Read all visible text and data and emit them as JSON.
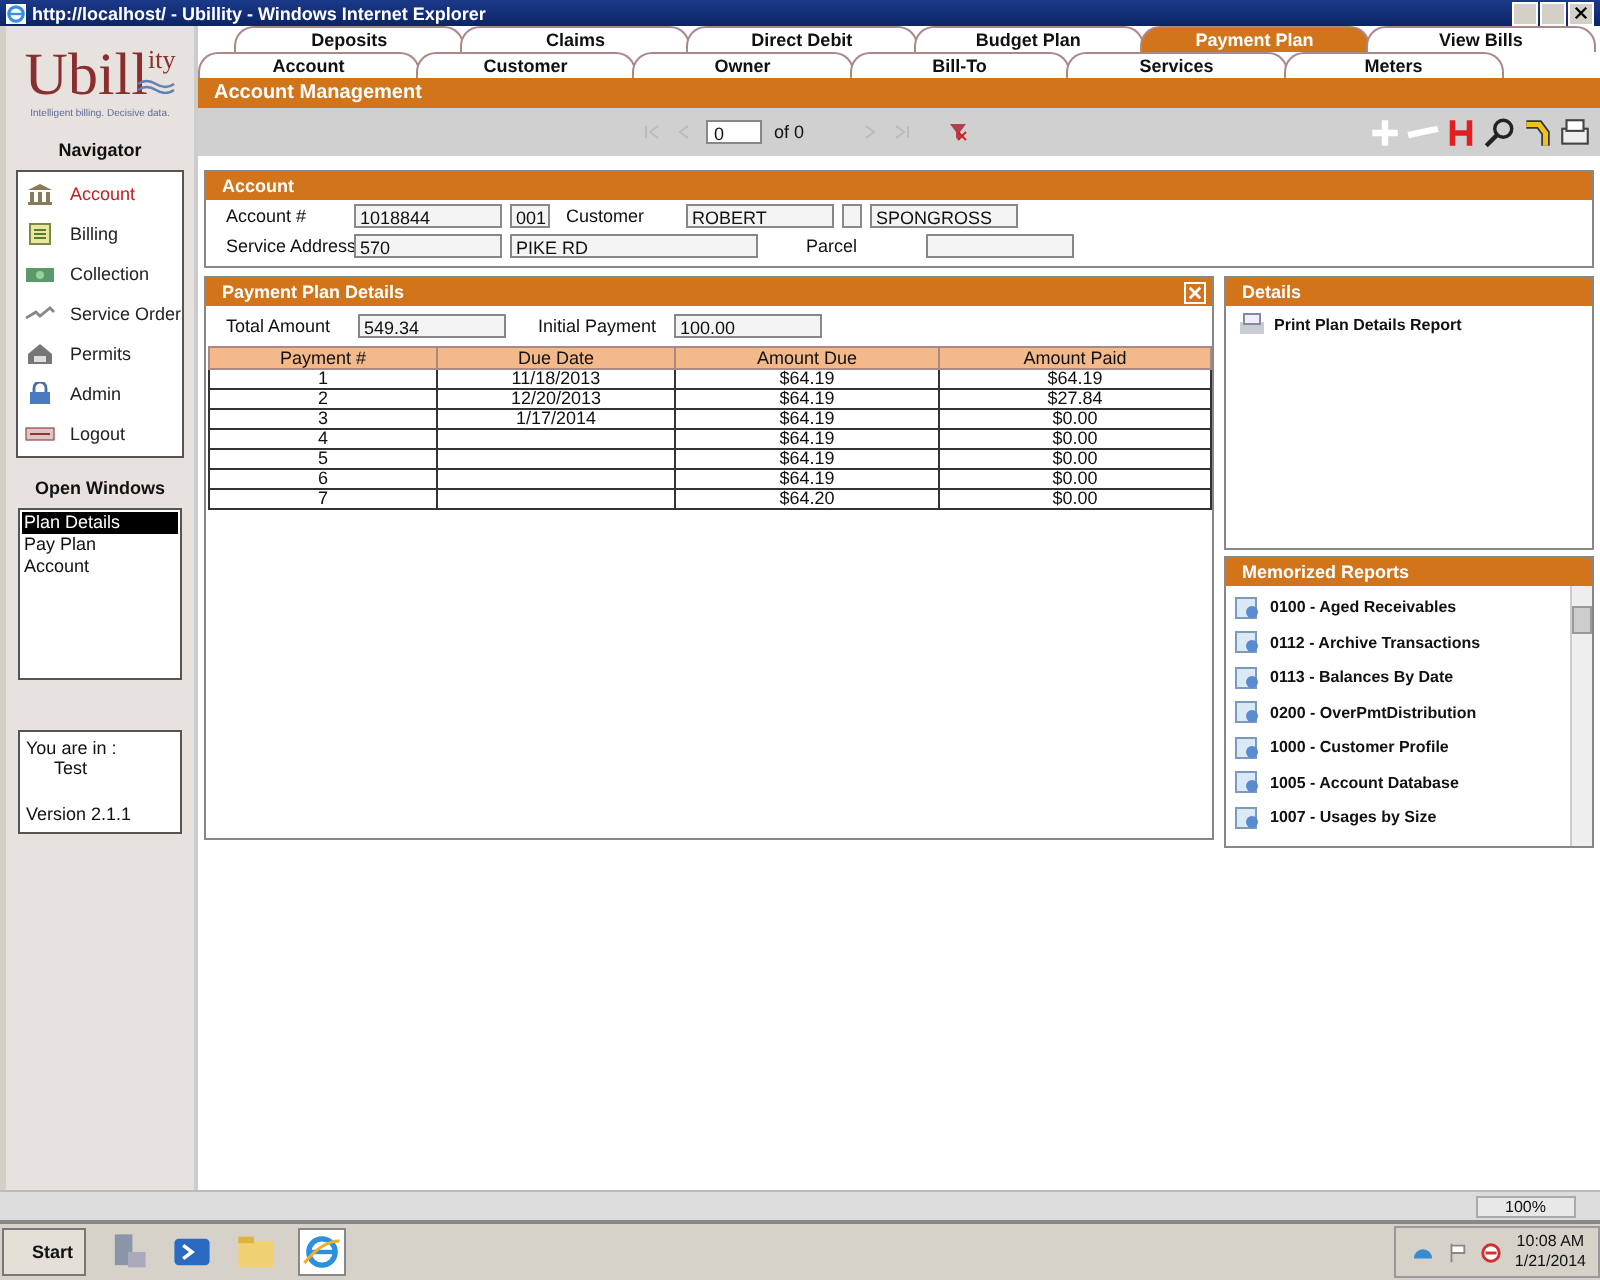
{
  "window": {
    "title": "http://localhost/ - Ubillity - Windows Internet Explorer"
  },
  "logo": {
    "main": "Ubill",
    "sup": "ity",
    "tagline": "Intelligent billing. Decisive data."
  },
  "navigator": {
    "title": "Navigator",
    "items": [
      {
        "label": "Account",
        "kind": "bank",
        "selected": true
      },
      {
        "label": "Billing",
        "kind": "ledger",
        "selected": false
      },
      {
        "label": "Collection",
        "kind": "money",
        "selected": false
      },
      {
        "label": "Service Order",
        "kind": "wrench",
        "selected": false
      },
      {
        "label": "Permits",
        "kind": "house",
        "selected": false
      },
      {
        "label": "Admin",
        "kind": "lock",
        "selected": false
      },
      {
        "label": "Logout",
        "kind": "exit",
        "selected": false
      }
    ]
  },
  "open_windows": {
    "title": "Open Windows",
    "items": [
      {
        "label": "Plan Details",
        "selected": true
      },
      {
        "label": "Pay Plan",
        "selected": false
      },
      {
        "label": "Account",
        "selected": false
      }
    ]
  },
  "session": {
    "line": "You are in :",
    "env": "Test",
    "version": "Version 2.1.1"
  },
  "tabs": {
    "row_1": [
      {
        "label": "Deposits",
        "selected": false
      },
      {
        "label": "Claims",
        "selected": false
      },
      {
        "label": "Direct Debit",
        "selected": false
      },
      {
        "label": "Budget Plan",
        "selected": false
      },
      {
        "label": "Payment Plan",
        "selected": true
      },
      {
        "label": "View Bills",
        "selected": false
      }
    ],
    "row_2": [
      {
        "label": "Account",
        "selected": false
      },
      {
        "label": "Customer",
        "selected": false
      },
      {
        "label": "Owner",
        "selected": false
      },
      {
        "label": "Bill-To",
        "selected": false
      },
      {
        "label": "Services",
        "selected": false
      },
      {
        "label": "Meters",
        "selected": false
      }
    ]
  },
  "header": "Account Management",
  "pager": {
    "value": "0",
    "total": "of 0"
  },
  "account": {
    "title": "Account",
    "rows": [
      [
        {
          "kind": "label",
          "text": "Account #"
        },
        {
          "kind": "input",
          "value": "1018844"
        },
        {
          "kind": "input",
          "value": "001"
        },
        {
          "kind": "label",
          "text": "Customer"
        },
        {
          "kind": "input",
          "value": "ROBERT"
        },
        {
          "kind": "input"
        },
        {
          "kind": "input",
          "value": "SPONGROSS"
        }
      ],
      [
        {
          "kind": "label",
          "text": "Service Address"
        },
        {
          "kind": "input",
          "value": "570"
        },
        {
          "kind": "input",
          "value": "PIKE RD"
        },
        {
          "kind": "label",
          "text": "Parcel"
        },
        {
          "kind": "input"
        }
      ]
    ]
  },
  "plan": {
    "title": "Payment Plan Details",
    "total_label": "Total Amount",
    "total_value": "549.34",
    "initial_label": "Initial Payment",
    "initial_value": "100.00",
    "columns": [
      "Payment #",
      "Due Date",
      "Amount Due",
      "Amount Paid"
    ],
    "rows": [
      [
        "1",
        "11/18/2013",
        "$64.19",
        "$64.19"
      ],
      [
        "2",
        "12/20/2013",
        "$64.19",
        "$27.84"
      ],
      [
        "3",
        "1/17/2014",
        "$64.19",
        "$0.00"
      ],
      [
        "4",
        "",
        "$64.19",
        "$0.00"
      ],
      [
        "5",
        "",
        "$64.19",
        "$0.00"
      ],
      [
        "6",
        "",
        "$64.19",
        "$0.00"
      ],
      [
        "7",
        "",
        "$64.20",
        "$0.00"
      ]
    ]
  },
  "details": {
    "title": "Details",
    "items": [
      "Print  Plan Details Report"
    ]
  },
  "reports": {
    "title": "Memorized Reports",
    "items": [
      "0100 - Aged Receivables",
      "0112 - Archive Transactions",
      "0113 - Balances By Date",
      "0200 - OverPmtDistribution",
      "1000 - Customer Profile",
      "1005 - Account Database",
      "1007 - Usages by Size"
    ]
  },
  "ie_status": {
    "zoom": "100%"
  },
  "taskbar": {
    "start": "Start",
    "time": "10:08 AM",
    "date": "1/21/2014"
  }
}
